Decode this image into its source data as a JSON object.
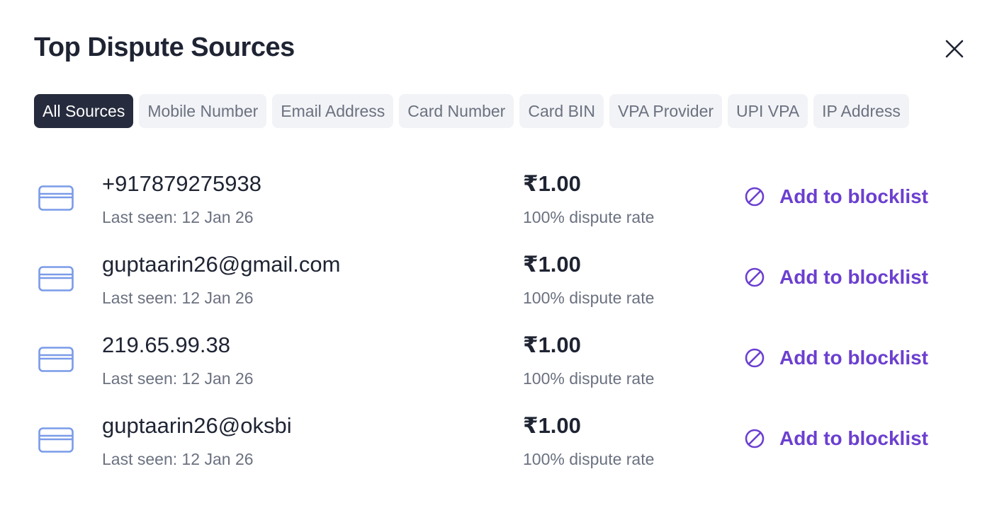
{
  "modal": {
    "title": "Top Dispute Sources"
  },
  "tabs": [
    {
      "label": "All Sources",
      "active": true
    },
    {
      "label": "Mobile Number",
      "active": false
    },
    {
      "label": "Email Address",
      "active": false
    },
    {
      "label": "Card Number",
      "active": false
    },
    {
      "label": "Card BIN",
      "active": false
    },
    {
      "label": "VPA Provider",
      "active": false
    },
    {
      "label": "UPI VPA",
      "active": false
    },
    {
      "label": "IP Address",
      "active": false
    }
  ],
  "rows": [
    {
      "icon": "credit-card-icon",
      "value": "+917879275938",
      "last_seen": "Last seen: 12 Jan 26",
      "amount": "₹1.00",
      "rate": "100% dispute rate",
      "action": "Add to blocklist"
    },
    {
      "icon": "credit-card-icon",
      "value": "guptaarin26@gmail.com",
      "last_seen": "Last seen: 12 Jan 26",
      "amount": "₹1.00",
      "rate": "100% dispute rate",
      "action": "Add to blocklist"
    },
    {
      "icon": "credit-card-icon",
      "value": "219.65.99.38",
      "last_seen": "Last seen: 12 Jan 26",
      "amount": "₹1.00",
      "rate": "100% dispute rate",
      "action": "Add to blocklist"
    },
    {
      "icon": "credit-card-icon",
      "value": "guptaarin26@oksbi",
      "last_seen": "Last seen: 12 Jan 26",
      "amount": "₹1.00",
      "rate": "100% dispute rate",
      "action": "Add to blocklist"
    }
  ],
  "colors": {
    "accent": "#6b3fd0",
    "active_tab": "#262b3d",
    "card_icon": "#7a9be8"
  }
}
